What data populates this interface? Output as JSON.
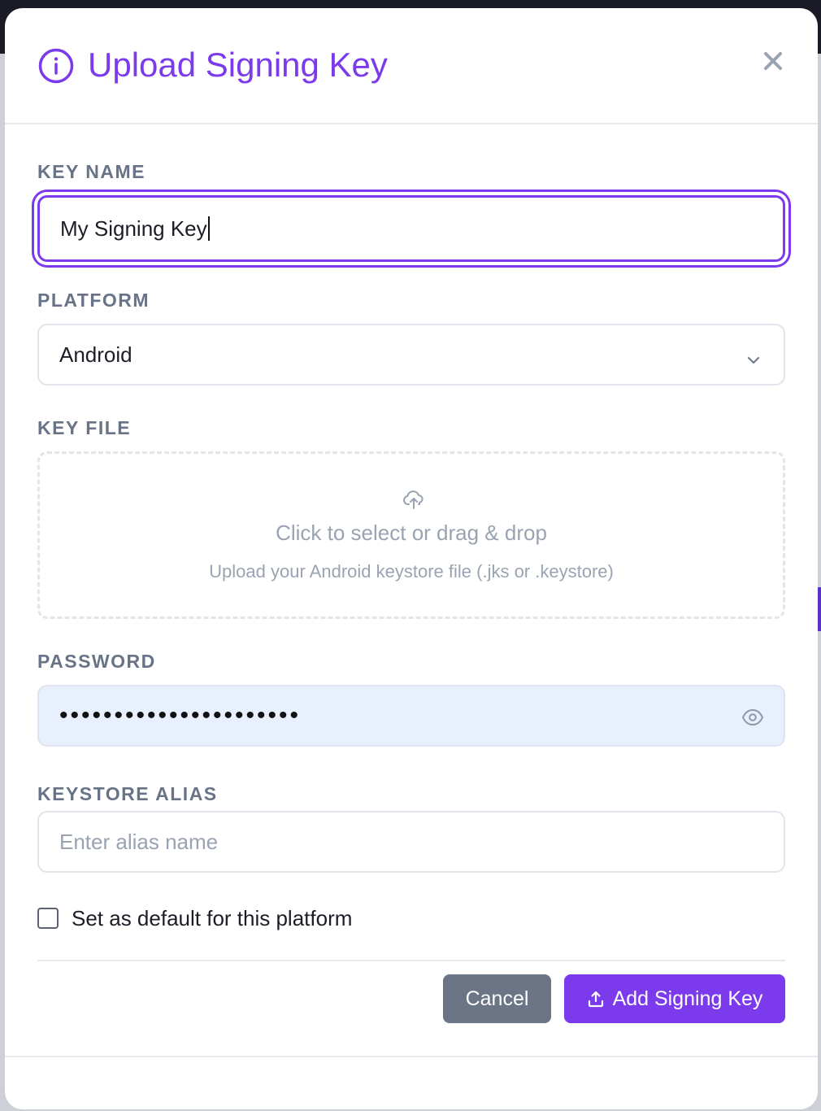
{
  "modal": {
    "title": "Upload Signing Key",
    "title_icon": "info-icon",
    "close_icon": "close-icon",
    "accent_color": "#7c3aed"
  },
  "form": {
    "key_name": {
      "label": "KEY NAME",
      "value": "My Signing Key"
    },
    "platform": {
      "label": "PLATFORM",
      "selected": "Android",
      "icon": "chevron-down-icon"
    },
    "key_file": {
      "label": "KEY FILE",
      "icon": "cloud-upload-icon",
      "title": "Click to select or drag & drop",
      "subtitle": "Upload your Android keystore file (.jks or .keystore)"
    },
    "password": {
      "label": "PASSWORD",
      "masked_value": "••••••••••••••••••••••",
      "icon": "eye-icon"
    },
    "keystore_alias": {
      "label": "KEYSTORE ALIAS",
      "value": "",
      "placeholder": "Enter alias name"
    },
    "default_checkbox": {
      "label": "Set as default for this platform",
      "checked": false
    }
  },
  "actions": {
    "cancel_label": "Cancel",
    "submit_label": "Add Signing Key",
    "submit_icon": "upload-icon",
    "cancel_color": "#6b7586"
  }
}
